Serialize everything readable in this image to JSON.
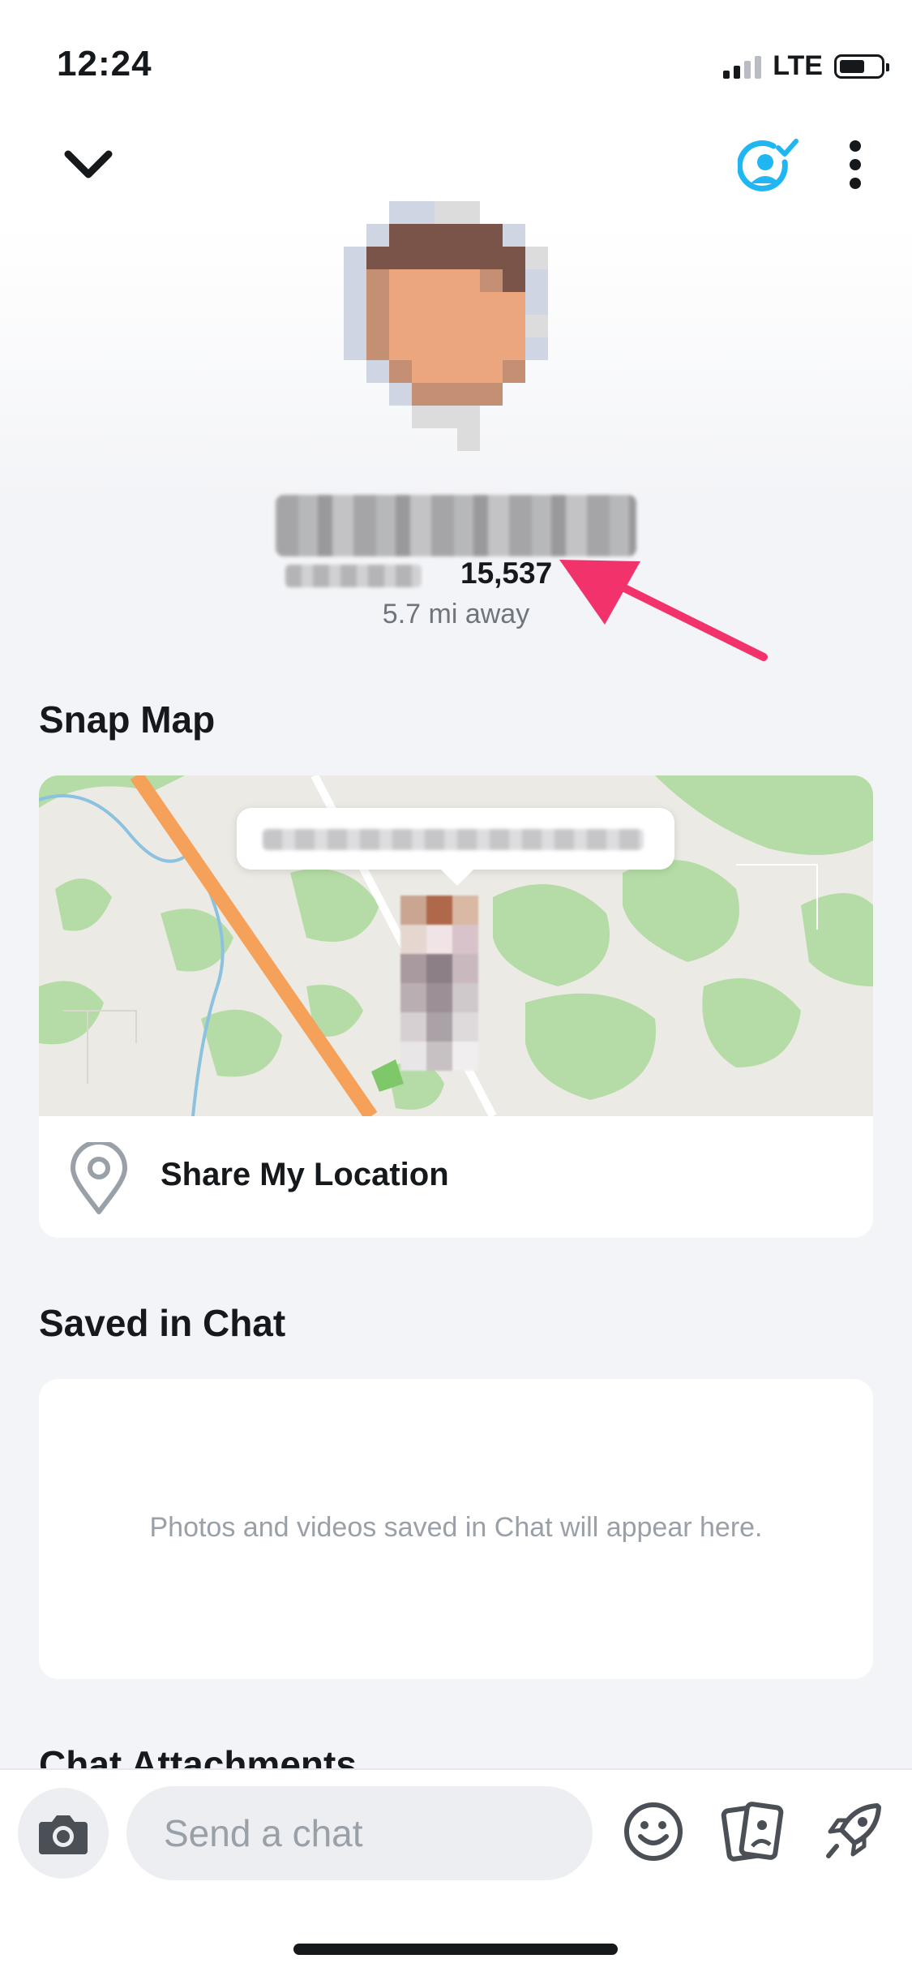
{
  "status_bar": {
    "time": "12:24",
    "network": "LTE",
    "battery_level": 0.62
  },
  "profile": {
    "snap_score": "15,537",
    "distance": "5.7 mi away"
  },
  "snap_map": {
    "title": "Snap Map",
    "share_label": "Share My Location"
  },
  "saved": {
    "title": "Saved in Chat",
    "empty_text": "Photos and videos saved in Chat will appear here."
  },
  "attachments": {
    "title": "Chat Attachments"
  },
  "chat": {
    "placeholder": "Send a chat"
  },
  "colors": {
    "accent": "#1fb6f2",
    "annotation_arrow": "#f2336b",
    "road": "#f5a15a",
    "green_area": "#b5dca6"
  },
  "icons": [
    "chevron-down-icon",
    "friend-check-icon",
    "more-vertical-icon",
    "location-pin-icon",
    "camera-icon",
    "emoji-icon",
    "cards-icon",
    "rocket-icon"
  ]
}
